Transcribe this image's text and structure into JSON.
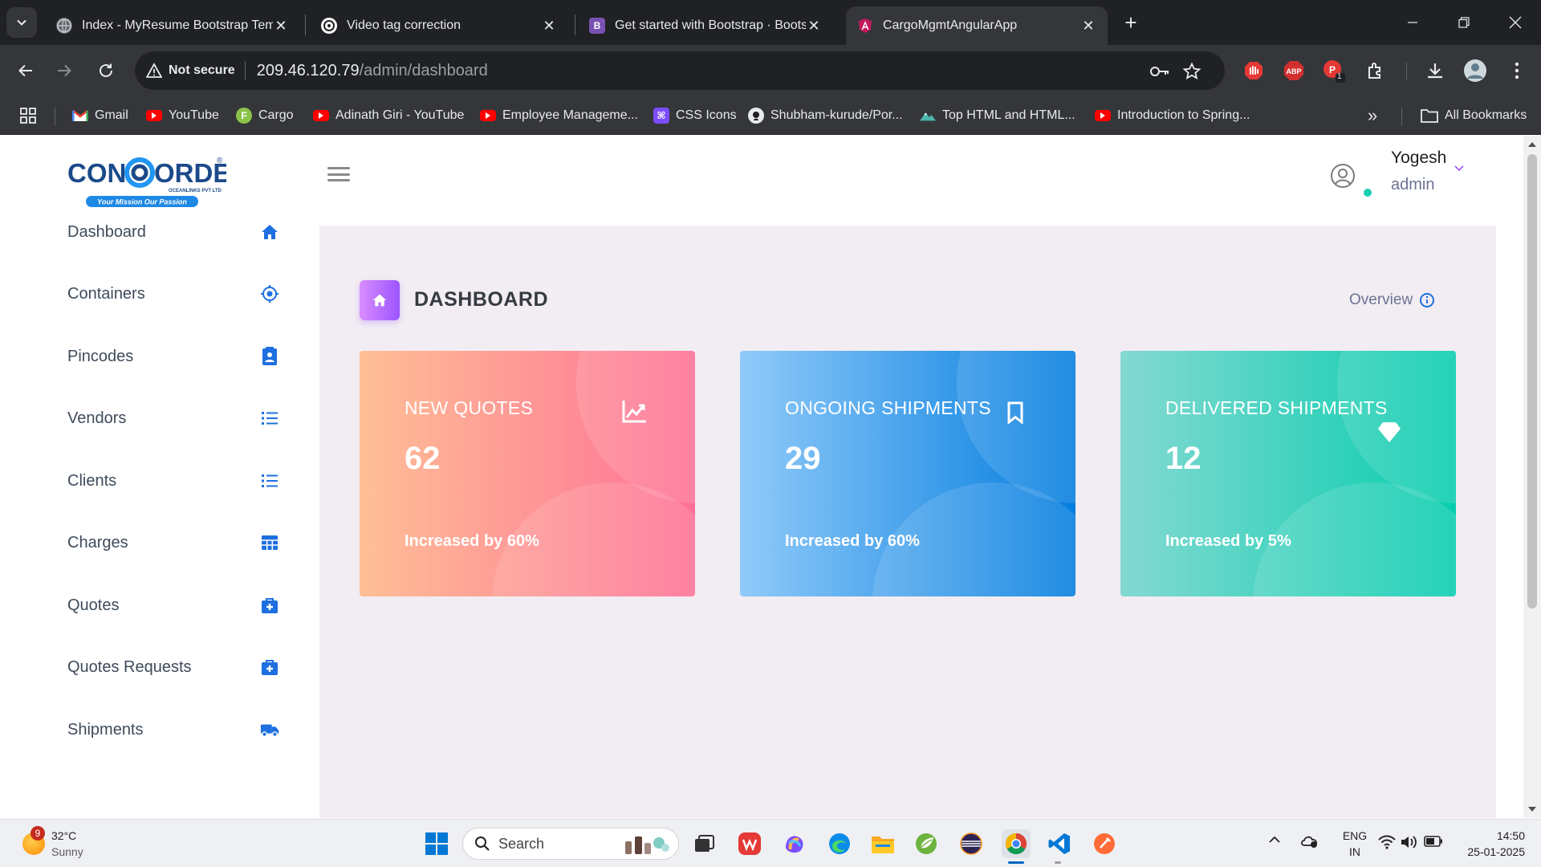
{
  "browser": {
    "tabs": [
      {
        "title": "Index - MyResume Bootstrap Temp",
        "active": false
      },
      {
        "title": "Video tag correction",
        "active": false
      },
      {
        "title": "Get started with Bootstrap · Bootst",
        "active": false
      },
      {
        "title": "CargoMgmtAngularApp",
        "active": true
      }
    ],
    "security_label": "Not secure",
    "url_host": "209.46.120.79",
    "url_path": "/admin/dashboard",
    "extension_badge": "1",
    "bookmarks": [
      {
        "label": "Gmail",
        "icon": "gmail-icon"
      },
      {
        "label": "YouTube",
        "icon": "youtube-icon"
      },
      {
        "label": "Cargo",
        "icon": "f-icon"
      },
      {
        "label": "Adinath Giri - YouTube",
        "icon": "youtube-icon"
      },
      {
        "label": "Employee Manageme...",
        "icon": "youtube-icon"
      },
      {
        "label": "CSS Icons",
        "icon": "css-icons-icon"
      },
      {
        "label": "Shubham-kurude/Por...",
        "icon": "github-icon"
      },
      {
        "label": "Top HTML and HTML...",
        "icon": "mountain-icon"
      },
      {
        "label": "Introduction to Spring...",
        "icon": "youtube-icon"
      }
    ],
    "all_bookmarks_label": "All Bookmarks",
    "overflow_label": "»"
  },
  "app": {
    "logo": {
      "text_left": "CON",
      "text_right": "ORDE",
      "subtitle": "OCEANLINKS PVT LTD",
      "tagline": "Your Mission Our Passion",
      "mark": "®"
    },
    "user": {
      "name": "Yogesh",
      "role": "admin"
    },
    "sidebar": [
      {
        "label": "Dashboard",
        "icon": "home-icon"
      },
      {
        "label": "Containers",
        "icon": "crosshairs-icon"
      },
      {
        "label": "Pincodes",
        "icon": "contact-card-icon"
      },
      {
        "label": "Vendors",
        "icon": "list-icon"
      },
      {
        "label": "Clients",
        "icon": "list-icon"
      },
      {
        "label": "Charges",
        "icon": "table-icon"
      },
      {
        "label": "Quotes",
        "icon": "medical-bag-icon"
      },
      {
        "label": "Quotes Requests",
        "icon": "medical-bag-icon"
      },
      {
        "label": "Shipments",
        "icon": "truck-icon"
      }
    ],
    "page_title": "DASHBOARD",
    "overview_label": "Overview",
    "cards": [
      {
        "title": "NEW QUOTES",
        "value": "62",
        "sub": "Increased by 60%",
        "icon": "chart-line-icon"
      },
      {
        "title": "ONGOING SHIPMENTS",
        "value": "29",
        "sub": "Increased by 60%",
        "icon": "bookmark-icon"
      },
      {
        "title": "DELIVERED SHIPMENTS",
        "value": "12",
        "sub": "Increased by 5%",
        "icon": "diamond-icon"
      }
    ]
  },
  "taskbar": {
    "weather": {
      "temp": "32°C",
      "condition": "Sunny",
      "badge": "9"
    },
    "search_placeholder": "Search",
    "language": "ENG",
    "region": "IN",
    "time": "14:50",
    "date": "25-01-2025"
  },
  "colors": {
    "accent_blue": "#047edf",
    "card_danger": [
      "#ffbf96",
      "#fe7096"
    ],
    "card_info": [
      "#90caf9",
      "#047edf"
    ],
    "card_success": [
      "#84d9d2",
      "#07cdae"
    ],
    "title_icon": [
      "#da8cff",
      "#9a55ff"
    ],
    "content_bg": "#f2edf3",
    "status_online": "#1bcfb4"
  }
}
